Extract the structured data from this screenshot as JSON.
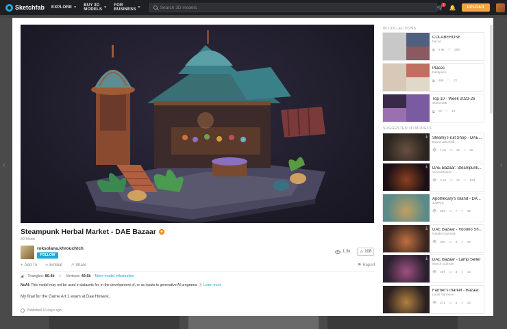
{
  "nav": {
    "brand": "Sketchfab",
    "items": [
      {
        "label": "EXPLORE"
      },
      {
        "label": "BUY 3D MODELS"
      },
      {
        "label": "FOR BUSINESS"
      }
    ],
    "search_placeholder": "Search 3D models",
    "cart_count": "1",
    "upload_label": "UPLOAD"
  },
  "model": {
    "title": "Steampunk Herbal Market - DAE Bazaar",
    "type": "3D Model",
    "author": "roksolana.khrouchtch",
    "follow_label": "FOLLOW",
    "views": "1.3k",
    "likes": "108",
    "actions": [
      "Add To",
      "Embed",
      "Share"
    ],
    "report_label": "Report",
    "triangles_label": "Triangles:",
    "triangles": "80.4k",
    "vertices_label": "Vertices:",
    "vertices": "49.5k",
    "more_info": "More model information",
    "notice_bold": "NoAI:",
    "notice": "This model may not be used in datasets for, in the development of, or as inputs to generative AI programs.",
    "learn_more": "Learn more",
    "description": "My final for the Game Art 1 exam at Dae Howest.",
    "published": "Published 16 days ago"
  },
  "collections": {
    "header": "IN COLLECTIONS",
    "items": [
      {
        "title": "COLABEROSE",
        "author": "hacos",
        "models": "4.9k",
        "likes": "289"
      },
      {
        "title": "Places",
        "author": "basspace",
        "models": "495",
        "likes": "22"
      },
      {
        "title": "Top 10 - Week 2023-26",
        "author": "Sketchfab",
        "models": "10",
        "likes": "14"
      }
    ]
  },
  "suggested": {
    "header": "SUGGESTED 3D MODELS",
    "items": [
      {
        "title": "Steamy Fruit Shop - DAE...",
        "author": "David Jakonžik",
        "views": "1.5k",
        "comments": "16",
        "likes": "85"
      },
      {
        "title": "DAE Bazaar: Steampunk...",
        "author": "vervoortward",
        "views": "3.4k",
        "comments": "12",
        "likes": "163"
      },
      {
        "title": "Apothecary's Island - DA...",
        "author": "JJORIS",
        "views": "303",
        "comments": "7",
        "likes": "38"
      },
      {
        "title": "DAE Bazaar - Voodoo Sh...",
        "author": "Natalia Grytsiuk",
        "views": "380",
        "comments": "8",
        "likes": "48"
      },
      {
        "title": "DAE Bazaar - Lamp Seller",
        "author": "March Gulman",
        "views": "487",
        "comments": "3",
        "likes": "42"
      },
      {
        "title": "Farmer's market - Bazaar",
        "author": "Louis Vanhove",
        "views": "272",
        "comments": "5",
        "likes": "16"
      }
    ]
  }
}
